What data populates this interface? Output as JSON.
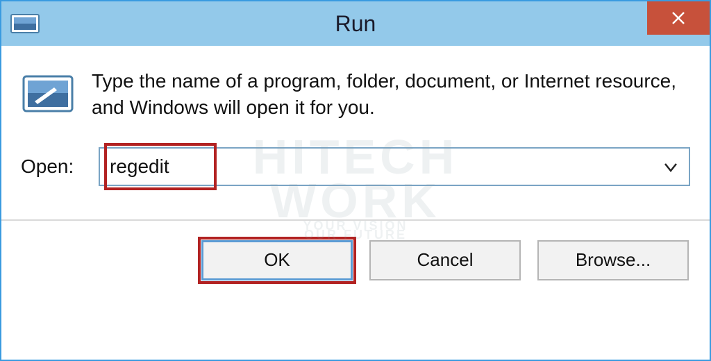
{
  "window": {
    "title": "Run",
    "close_icon": "close-icon"
  },
  "dialog": {
    "description": "Type the name of a program, folder, document, or Internet resource, and Windows will open it for you.",
    "open_label": "Open:",
    "input_value": "regedit"
  },
  "buttons": {
    "ok": "OK",
    "cancel": "Cancel",
    "browse": "Browse..."
  },
  "watermark": {
    "line1": "HITECH",
    "line2": "WORK",
    "tag1": "YOUR VISION",
    "tag2": "OUR FUTURE"
  },
  "highlights": {
    "typed_text": true,
    "ok_button": true
  },
  "colors": {
    "titlebar": "#93c9ea",
    "close": "#c7513b",
    "highlight": "#b22222",
    "default_button_border": "#5a9bd4"
  }
}
